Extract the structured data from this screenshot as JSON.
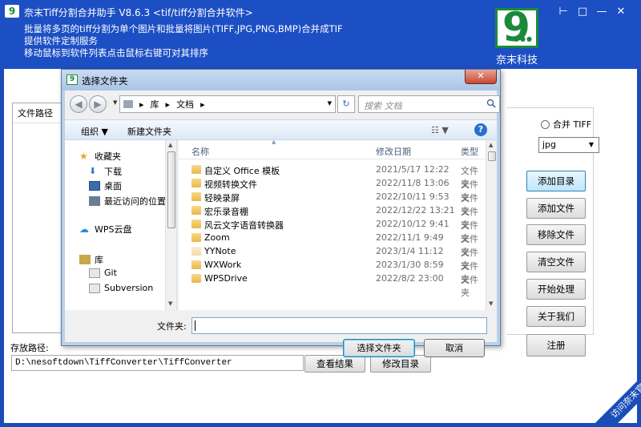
{
  "app": {
    "title": "奈末Tiff分割合并助手 V8.6.3    <tif/tiff分割合并软件>",
    "desc_lines": [
      "批量将多页的tiff分割为单个图片和批量将图片(TIFF,JPG,PNG,BMP)合并成TIF",
      "提供软件定制服务",
      "移动鼠标到软件列表点击鼠标右键可对其排序"
    ],
    "logo_text": "奈末科技",
    "icon": "app-logo-icon",
    "colors": {
      "header_bg": "#1d4fc4",
      "logo_green": "#1a8a3a"
    }
  },
  "window_controls": {
    "pin": "⊢",
    "restore": "□",
    "minimize": "—",
    "close": "✕"
  },
  "main": {
    "file_list_header": "文件路径",
    "save_path_label": "存放路径:",
    "save_path_value": "D:\\nesoftdown\\TiffConverter\\TiffConverter",
    "view_result_button": "查看结果",
    "modify_dir_button": "修改目录",
    "merge_tiff_label": "合并 TIFF",
    "format_select_value": "jpg",
    "side_buttons": [
      "添加目录",
      "添加文件",
      "移除文件",
      "清空文件",
      "开始处理",
      "关于我们",
      "注册"
    ],
    "corner_link": "访问奈末官网"
  },
  "dialog": {
    "title": "选择文件夹",
    "close_label": "✕",
    "breadcrumb": [
      "库",
      "文档"
    ],
    "search_placeholder": "搜索 文档",
    "toolbar": {
      "organize": "组织 ▼",
      "new_folder": "新建文件夹"
    },
    "nav_pane": {
      "favorites": "收藏夹",
      "downloads": "下载",
      "desktop": "桌面",
      "recent": "最近访问的位置",
      "wps_cloud": "WPS云盘",
      "libraries": "库",
      "git": "Git",
      "subversion": "Subversion"
    },
    "columns": {
      "name": "名称",
      "date": "修改日期",
      "type": "类型"
    },
    "files": [
      {
        "name": "自定义 Office 模板",
        "date": "2021/5/17 12:22",
        "type": "文件夹"
      },
      {
        "name": "视频转换文件",
        "date": "2022/11/8 13:06",
        "type": "文件夹"
      },
      {
        "name": "轻映录屏",
        "date": "2022/10/11 9:53",
        "type": "文件夹"
      },
      {
        "name": "宏乐录音棚",
        "date": "2022/12/22 13:21",
        "type": "文件夹"
      },
      {
        "name": "风云文字语音转换器",
        "date": "2022/10/12 9:41",
        "type": "文件夹"
      },
      {
        "name": "Zoom",
        "date": "2022/11/1 9:49",
        "type": "文件夹"
      },
      {
        "name": "YYNote",
        "date": "2023/1/4 11:12",
        "type": "文件夹"
      },
      {
        "name": "WXWork",
        "date": "2023/1/30 8:59",
        "type": "文件夹"
      },
      {
        "name": "WPSDrive",
        "date": "2022/8/2 23:00",
        "type": "文件夹"
      }
    ],
    "folder_label": "文件夹:",
    "folder_value": "",
    "select_button": "选择文件夹",
    "cancel_button": "取消"
  }
}
